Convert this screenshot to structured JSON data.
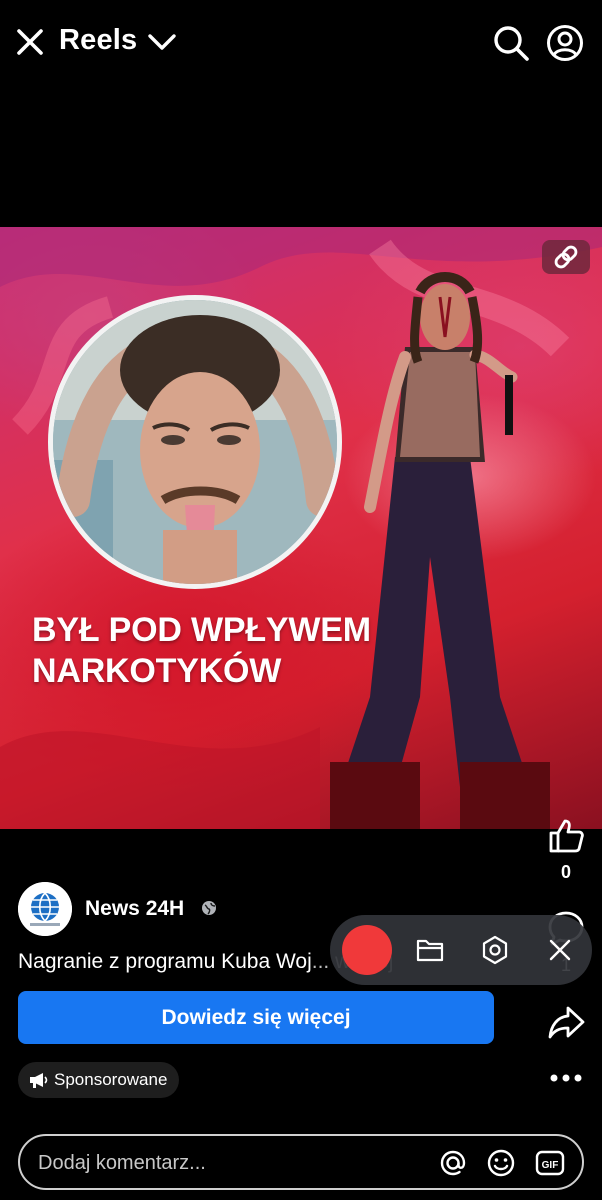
{
  "header": {
    "title": "Reels",
    "icons": {
      "close": "close-icon",
      "dropdown": "chevron-down-icon",
      "search": "search-icon",
      "profile": "profile-icon"
    }
  },
  "media": {
    "headline_line1": "BYŁ POD WPŁYWEM",
    "headline_line2": "NARKOTYKÓW",
    "link_icon": "link-icon",
    "accent": "#e0304a"
  },
  "actions": {
    "like_count": "0",
    "comment_count": "1",
    "icons": {
      "like": "thumbs-up-icon",
      "comment": "comment-icon",
      "share": "share-icon",
      "more": "more-icon"
    }
  },
  "post": {
    "author": "News 24H",
    "visibility_icon": "globe-icon",
    "caption_start": "Nagranie z programu Kuba Woj",
    "caption_more": "... więcej",
    "cta_label": "Dowiedz się więcej",
    "sponsored_label": "Sponsorowane",
    "cta_color": "#1877f2"
  },
  "recorder": {
    "icons": {
      "record": "record-icon",
      "folder": "folder-icon",
      "settings": "settings-icon",
      "close": "close-icon"
    },
    "record_color": "#f0393a"
  },
  "comment": {
    "placeholder": "Dodaj komentarz...",
    "icons": {
      "mention": "at-icon",
      "emoji": "emoji-icon",
      "gif": "gif-icon"
    }
  }
}
